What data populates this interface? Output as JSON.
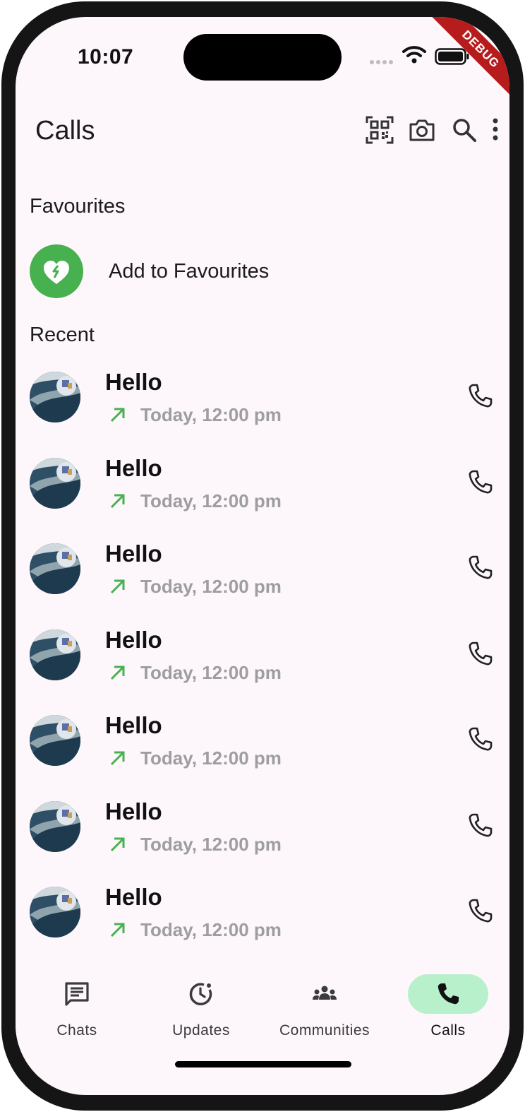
{
  "status_bar": {
    "time": "10:07",
    "debug_banner": "DEBUG"
  },
  "appbar": {
    "title": "Calls",
    "actions": [
      {
        "icon": "qr-scan-icon"
      },
      {
        "icon": "camera-icon"
      },
      {
        "icon": "search-icon"
      },
      {
        "icon": "more-vert-icon"
      }
    ]
  },
  "favourites": {
    "section_label": "Favourites",
    "add_label": "Add to Favourites",
    "icon": "heart-add-icon",
    "color": "#47b04f"
  },
  "recent": {
    "section_label": "Recent",
    "calls": [
      {
        "name": "Hello",
        "time": "Today, 12:00 pm",
        "direction_icon": "outgoing-call-arrow-icon",
        "action_icon": "phone-icon"
      },
      {
        "name": "Hello",
        "time": "Today, 12:00 pm",
        "direction_icon": "outgoing-call-arrow-icon",
        "action_icon": "phone-icon"
      },
      {
        "name": "Hello",
        "time": "Today, 12:00 pm",
        "direction_icon": "outgoing-call-arrow-icon",
        "action_icon": "phone-icon"
      },
      {
        "name": "Hello",
        "time": "Today, 12:00 pm",
        "direction_icon": "outgoing-call-arrow-icon",
        "action_icon": "phone-icon"
      },
      {
        "name": "Hello",
        "time": "Today, 12:00 pm",
        "direction_icon": "outgoing-call-arrow-icon",
        "action_icon": "phone-icon"
      },
      {
        "name": "Hello",
        "time": "Today, 12:00 pm",
        "direction_icon": "outgoing-call-arrow-icon",
        "action_icon": "phone-icon"
      },
      {
        "name": "Hello",
        "time": "Today, 12:00 pm",
        "direction_icon": "outgoing-call-arrow-icon",
        "action_icon": "phone-icon"
      }
    ]
  },
  "bottom_nav": {
    "items": [
      {
        "label": "Chats",
        "icon": "chat-icon",
        "active": false
      },
      {
        "label": "Updates",
        "icon": "updates-icon",
        "active": false
      },
      {
        "label": "Communities",
        "icon": "communities-icon",
        "active": false
      },
      {
        "label": "Calls",
        "icon": "phone-icon",
        "active": true
      }
    ],
    "active_color": "#b8f0cc"
  }
}
